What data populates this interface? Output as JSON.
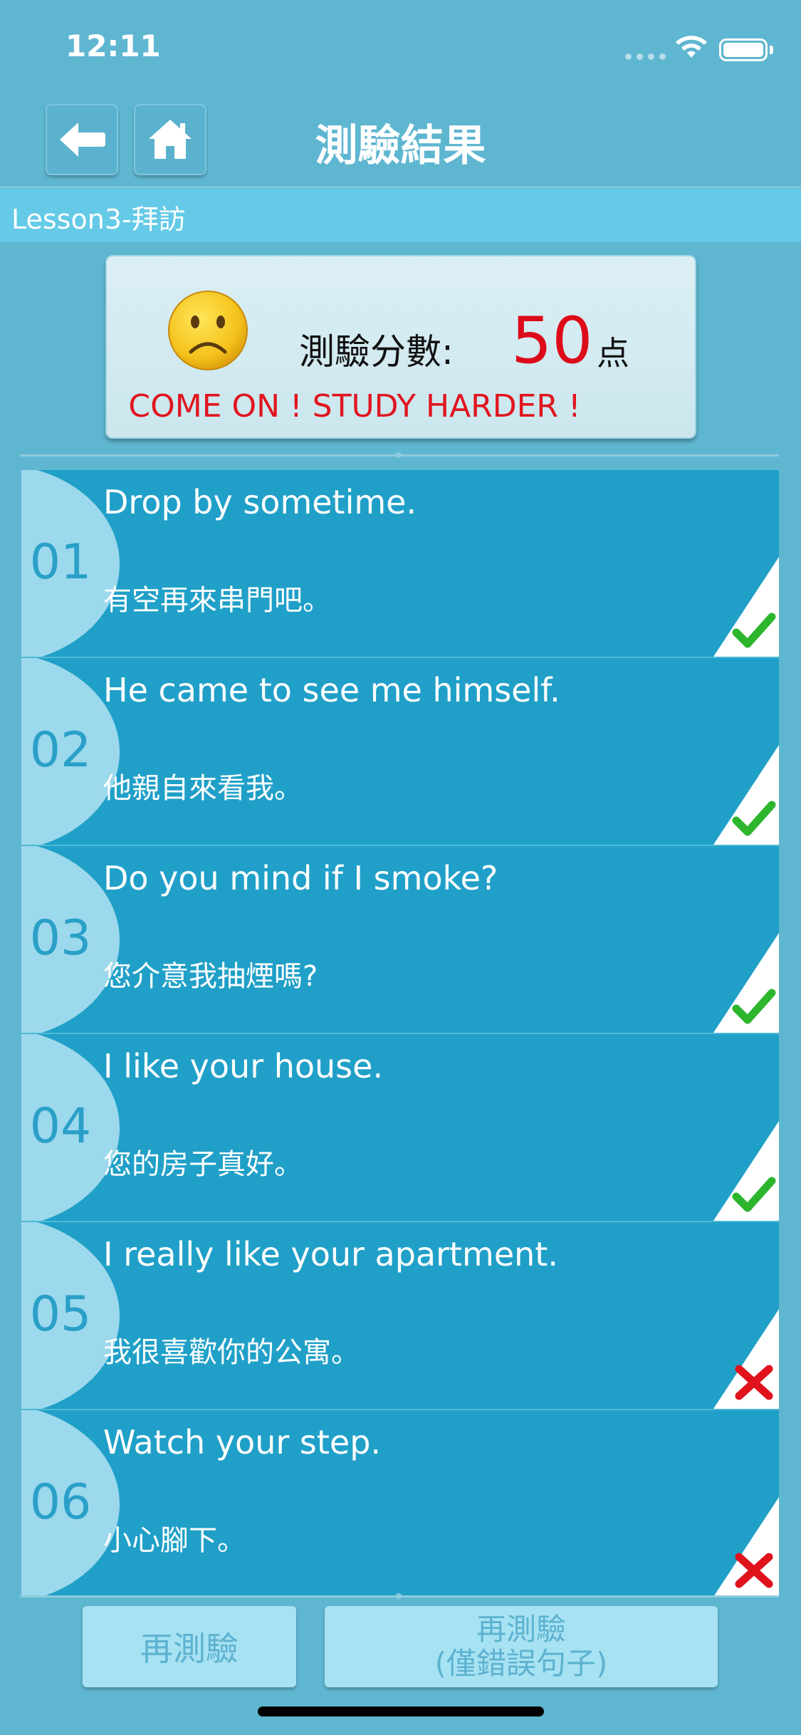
{
  "status_bar": {
    "time": "12:11"
  },
  "header": {
    "title": "測驗結果"
  },
  "lesson": {
    "title": "Lesson3-拜訪"
  },
  "score": {
    "label": "測驗分數:",
    "value": "50",
    "unit": "点",
    "message": "COME ON ! STUDY HARDER !",
    "face_icon": "sad-face-icon"
  },
  "results": [
    {
      "num": "01",
      "english": "Drop by sometime.",
      "chinese": "有空再來串門吧。",
      "correct": true
    },
    {
      "num": "02",
      "english": "He came to see me himself.",
      "chinese": "他親自來看我。",
      "correct": true
    },
    {
      "num": "03",
      "english": "Do you mind if I smoke?",
      "chinese": "您介意我抽煙嗎?",
      "correct": true
    },
    {
      "num": "04",
      "english": "I like your house.",
      "chinese": "您的房子真好。",
      "correct": true
    },
    {
      "num": "05",
      "english": "I really like your apartment.",
      "chinese": "我很喜歡你的公寓。",
      "correct": false
    },
    {
      "num": "06",
      "english": "Watch your step.",
      "chinese": "小心腳下。",
      "correct": false
    }
  ],
  "buttons": {
    "retest": "再測驗",
    "retest_wrong_line1": "再測驗",
    "retest_wrong_line2": "(僅錯誤句子)"
  },
  "colors": {
    "background": "#5FB6D1",
    "row": "#20A0C8",
    "score": "#DD0A1A",
    "check": "#2DB52D",
    "cross": "#E0121C"
  }
}
